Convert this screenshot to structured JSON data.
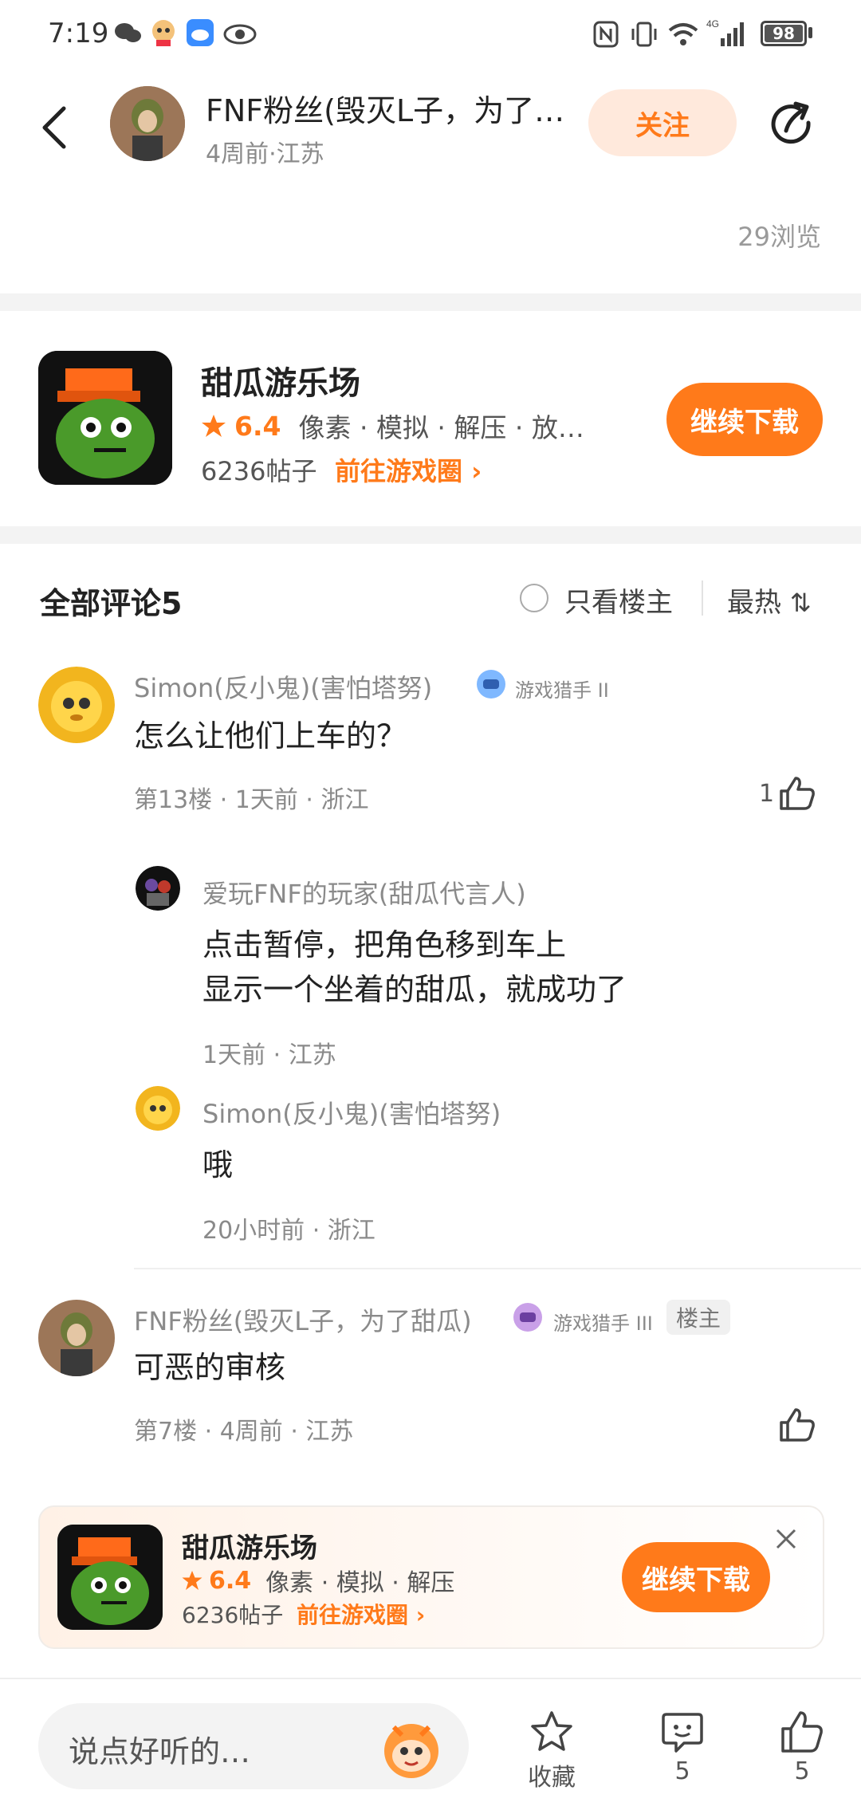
{
  "status_bar": {
    "time": "7:19",
    "battery": "98"
  },
  "header": {
    "author_name": "FNF粉丝(毁灭L子，为了…",
    "subline": "4周前·江苏",
    "follow_label": "关注",
    "views": "29浏览"
  },
  "game_card": {
    "name": "甜瓜游乐场",
    "rating": "6.4",
    "tags": "像素 · 模拟 · 解压 · 放…",
    "posts": "6236帖子",
    "goto": "前往游戏圈",
    "download": "继续下载"
  },
  "comments_header": {
    "title": "全部评论5",
    "only_author": "只看楼主",
    "sort": "最热"
  },
  "comments": [
    {
      "name": "Simon(反小鬼)(害怕塔努)",
      "badge": "游戏猎手 II",
      "text": "怎么让他们上车的？",
      "meta": "第13楼 · 1天前 · 浙江",
      "likes": "1",
      "replies": [
        {
          "name": "爱玩FNF的玩家(甜瓜代言人)",
          "line1": "点击暂停，把角色移到车上",
          "line2": "显示一个坐着的甜瓜，就成功了",
          "meta": "1天前 · 江苏"
        },
        {
          "name": "Simon(反小鬼)(害怕塔努)",
          "line1": "哦",
          "meta": "20小时前 · 浙江"
        }
      ]
    },
    {
      "name": "FNF粉丝(毁灭L子，为了甜瓜)",
      "badge": "游戏猎手 III",
      "owner_tag": "楼主",
      "text": "可恶的审核",
      "meta": "第7楼 · 4周前 · 江苏"
    }
  ],
  "banner": {
    "name": "甜瓜游乐场",
    "rating": "6.4",
    "tags": "像素 · 模拟 · 解压",
    "posts": "6236帖子",
    "goto": "前往游戏圈",
    "download": "继续下载"
  },
  "bottom_bar": {
    "placeholder": "说点好听的…",
    "favorite": "收藏",
    "comments": "5",
    "likes": "5"
  },
  "colors": {
    "accent": "#ff7a1a",
    "follow_bg": "#ffe9dc"
  }
}
